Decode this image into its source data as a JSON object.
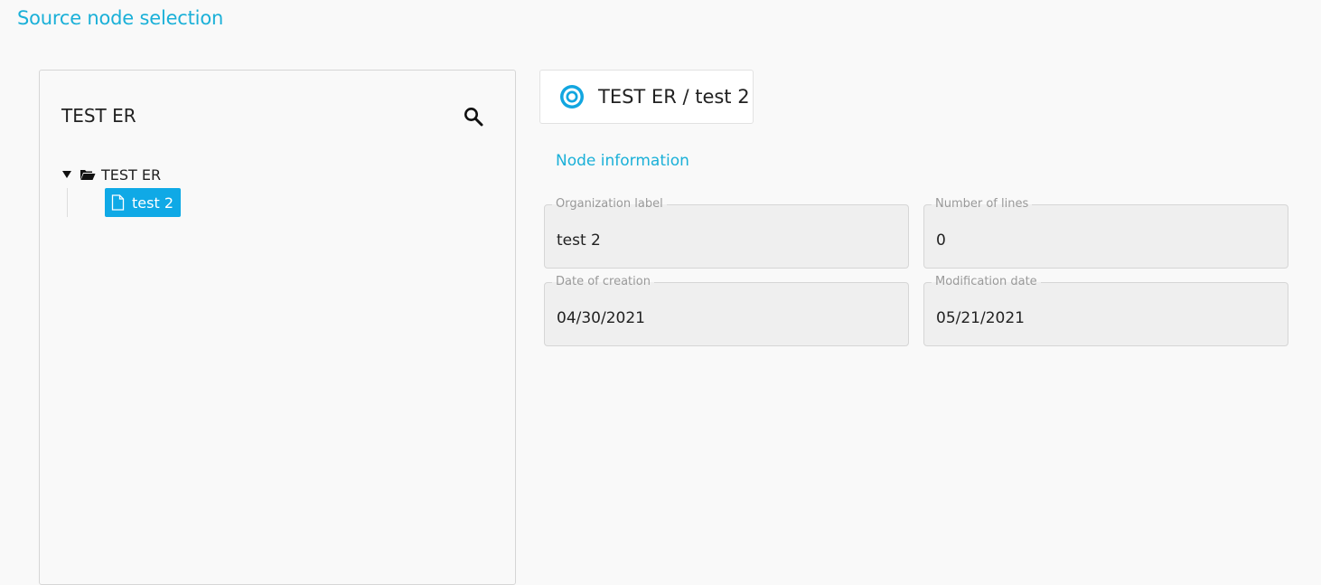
{
  "page": {
    "title": "Source node selection"
  },
  "tree_panel": {
    "header": "TEST ER",
    "search_icon": "search-icon",
    "root": {
      "label": "TEST ER",
      "icon": "folder-open-icon",
      "expanded": true
    },
    "children": [
      {
        "label": "test 2",
        "icon": "file-icon",
        "selected": true
      }
    ]
  },
  "detail": {
    "breadcrumb": "TEST ER / test 2",
    "breadcrumb_icon": "radio-target-icon",
    "section_title": "Node information",
    "fields": {
      "organization_label": {
        "label": "Organization label",
        "value": "test 2"
      },
      "number_of_lines": {
        "label": "Number of lines",
        "value": "0"
      },
      "date_of_creation": {
        "label": "Date of creation",
        "value": "04/30/2021"
      },
      "modification_date": {
        "label": "Modification date",
        "value": "05/21/2021"
      }
    }
  },
  "colors": {
    "accent": "#1ab0d8",
    "selected_bg": "#0fa9e6",
    "field_bg": "#efefef",
    "page_bg": "#f9f9f9"
  }
}
